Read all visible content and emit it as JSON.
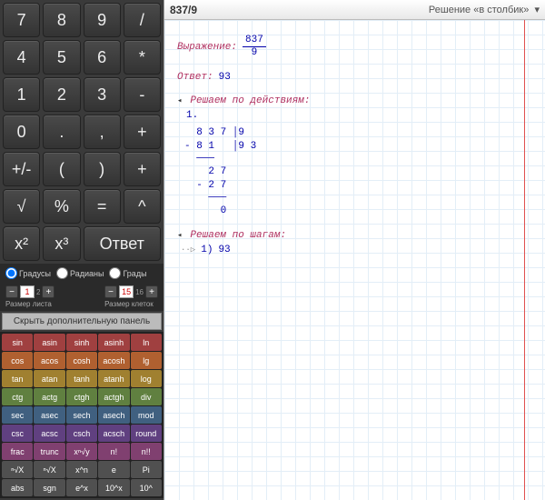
{
  "header": {
    "expression": "837/9",
    "mode": "Решение «в столбик»",
    "arrow": "▾"
  },
  "keys": [
    [
      "7",
      "8",
      "9",
      "/"
    ],
    [
      "4",
      "5",
      "6",
      "*"
    ],
    [
      "1",
      "2",
      "3",
      "-"
    ],
    [
      "0",
      ".",
      ",",
      "+"
    ],
    [
      "+/-",
      "(",
      ")",
      "+"
    ],
    [
      "√",
      "%",
      "=",
      "^"
    ],
    [
      "x²",
      "x³",
      "Ответ",
      ""
    ]
  ],
  "mode_group": {
    "deg": "Градусы",
    "rad": "Радианы",
    "grad": "Грады"
  },
  "sheet_size": {
    "value": "1",
    "label": "Размер листа",
    "suffix": "2"
  },
  "cell_size": {
    "value": "15",
    "label": "Размер клеток",
    "suffix": "16"
  },
  "hide_panel": "Скрыть дополнительную панель",
  "fn_rows": [
    {
      "cls": "rA",
      "items": [
        "sin",
        "asin",
        "sinh",
        "asinh",
        "ln"
      ]
    },
    {
      "cls": "rB",
      "items": [
        "cos",
        "acos",
        "cosh",
        "acosh",
        "lg"
      ]
    },
    {
      "cls": "rC",
      "items": [
        "tan",
        "atan",
        "tanh",
        "atanh",
        "log"
      ]
    },
    {
      "cls": "rD",
      "items": [
        "ctg",
        "actg",
        "ctgh",
        "actgh",
        "div"
      ]
    },
    {
      "cls": "rE",
      "items": [
        "sec",
        "asec",
        "sech",
        "asech",
        "mod"
      ]
    },
    {
      "cls": "rF",
      "items": [
        "csc",
        "acsc",
        "csch",
        "acsch",
        "round"
      ]
    },
    {
      "cls": "rG",
      "items": [
        "frac",
        "trunc",
        "xⁿ√y",
        "n!",
        "n!!"
      ]
    },
    {
      "cls": "rH",
      "items": [
        "ⁿ√X",
        "ⁿ√X",
        "x^n",
        "e",
        "Pi"
      ]
    },
    {
      "cls": "rH",
      "items": [
        "abs",
        "sgn",
        "e^x",
        "10^x",
        "10^"
      ]
    }
  ],
  "notebook": {
    "expr_label": "Выражение:",
    "expr_num": "837",
    "expr_den": "9",
    "answer_label": "Ответ:",
    "answer_value": "93",
    "section1": "Решаем по действиям:",
    "step1": "1.",
    "longdiv": "  8 3 7 │9\n- 8 1   │9 3\n  ───\n    2 7\n  - 2 7\n    ───\n      0",
    "section2": "Решаем по шагам:",
    "step2_prefix": "1)",
    "step2_val": "93"
  }
}
